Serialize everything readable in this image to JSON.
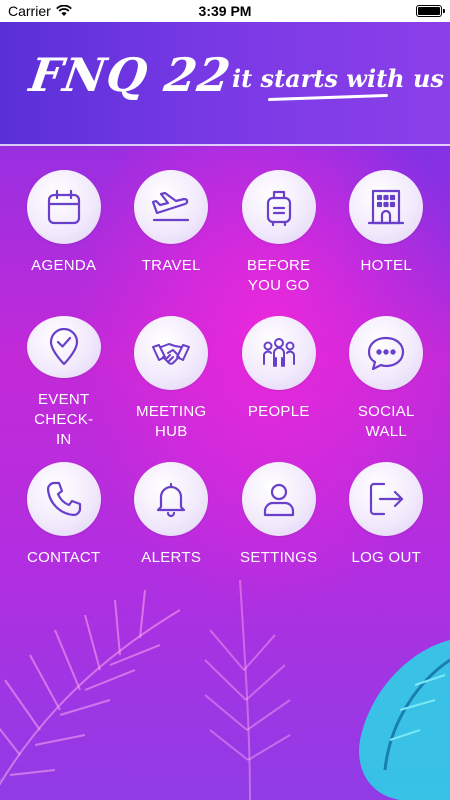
{
  "status_bar": {
    "carrier": "Carrier",
    "time": "3:39 PM"
  },
  "header": {
    "logo": "FNQ 22",
    "tagline": "it starts with us"
  },
  "menu": {
    "items": [
      {
        "label": "AGENDA",
        "icon": "calendar-icon"
      },
      {
        "label": "TRAVEL",
        "icon": "airplane-icon"
      },
      {
        "label": "BEFORE\nYOU GO",
        "icon": "luggage-icon"
      },
      {
        "label": "HOTEL",
        "icon": "hotel-icon"
      },
      {
        "label": "EVENT\nCHECK-\nIN",
        "icon": "location-check-icon"
      },
      {
        "label": "MEETING\nHUB",
        "icon": "handshake-icon"
      },
      {
        "label": "PEOPLE",
        "icon": "people-icon"
      },
      {
        "label": "SOCIAL\nWALL",
        "icon": "chat-bubble-icon"
      },
      {
        "label": "CONTACT",
        "icon": "phone-icon"
      },
      {
        "label": "ALERTS",
        "icon": "bell-icon"
      },
      {
        "label": "SETTINGS",
        "icon": "user-icon"
      },
      {
        "label": "LOG OUT",
        "icon": "logout-icon"
      }
    ]
  },
  "colors": {
    "icon_stroke": "#6a3fc9",
    "accent_teal": "#2fd0e6"
  }
}
